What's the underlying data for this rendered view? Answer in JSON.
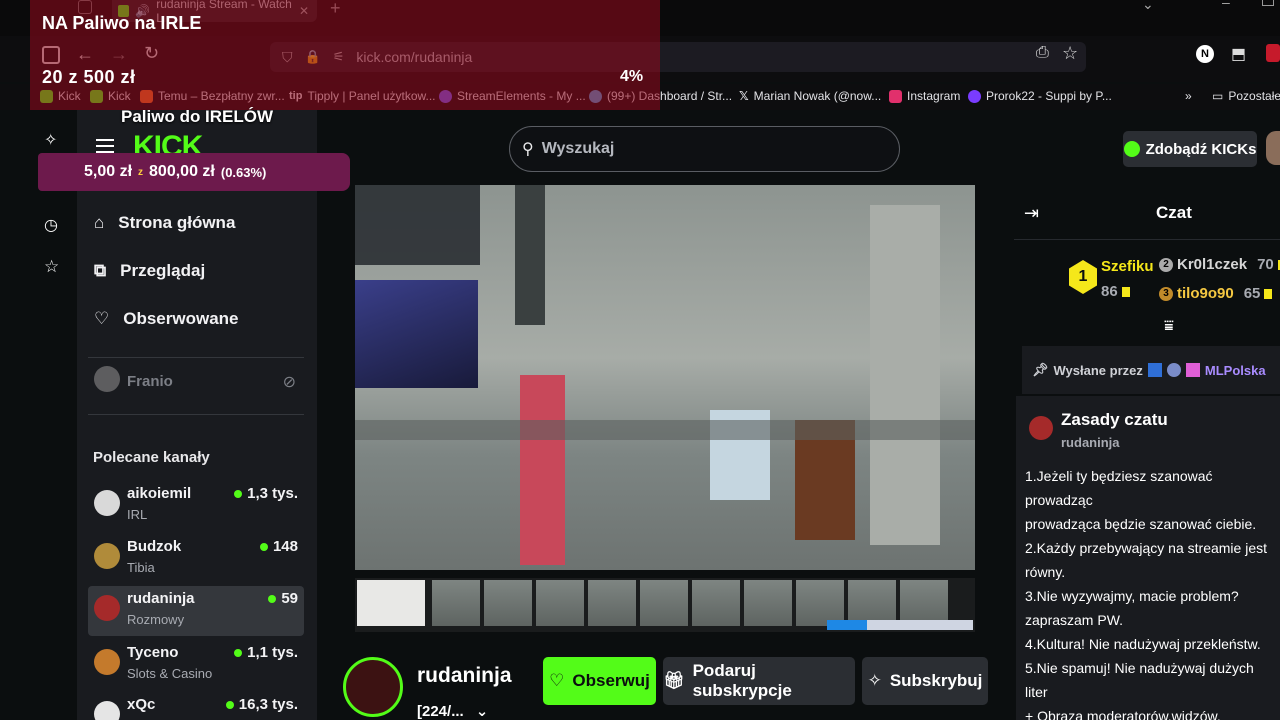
{
  "browser": {
    "tab_title": "rudaninja Stream - Watch L",
    "url": "kick.com/rudaninja",
    "bookmarks": [
      {
        "label": "Kick",
        "color": "#53fc18"
      },
      {
        "label": "Kick",
        "color": "#53fc18"
      },
      {
        "label": "Temu – Bezpłatny zwr...",
        "color": "#f37021"
      },
      {
        "label": "Tipply | Panel użytkow...",
        "color": "#1f1f22"
      },
      {
        "label": "StreamElements - My ...",
        "color": "#6e5cff"
      },
      {
        "label": "(99+) Dashboard / Str...",
        "color": "#4aa3df"
      },
      {
        "label": "Marian Nowak (@now...",
        "color": "#000000"
      },
      {
        "label": "Instagram",
        "color": "#e1306c"
      },
      {
        "label": "Prorok22 - Suppi by P...",
        "color": "#7a3cff"
      }
    ],
    "bookmarks_other": "Pozostałe"
  },
  "overlay": {
    "goal_title": "NA Paliwo na IRLE",
    "goal_amount": "20  z  500  zł",
    "goal_percent": "4%",
    "irl_title": "Paliwo do IRELÓW",
    "irl_current": "5,00 zł",
    "irl_sep": "z",
    "irl_target": "800,00 zł",
    "irl_percent": "(0.63%)"
  },
  "kick": {
    "search_placeholder": "Wyszukaj",
    "kicks_button": "Zdobądź KICKs",
    "nav": [
      {
        "label": "Strona główna",
        "icon": "home-icon"
      },
      {
        "label": "Przeglądaj",
        "icon": "browse-icon"
      },
      {
        "label": "Obserwowane",
        "icon": "heart-icon"
      }
    ],
    "followed_user": "Franio",
    "recommended_header": "Polecane kanały",
    "channels": [
      {
        "name": "aikoiemil",
        "category": "IRL",
        "viewers": "1,3 tys.",
        "avatar": "#d9d9d9"
      },
      {
        "name": "Budzok",
        "category": "Tibia",
        "viewers": "148",
        "avatar": "#b08b3a"
      },
      {
        "name": "rudaninja",
        "category": "Rozmowy",
        "viewers": "59",
        "avatar": "#a52a2a"
      },
      {
        "name": "Tyceno",
        "category": "Slots & Casino",
        "viewers": "1,1 tys.",
        "avatar": "#c47a2c"
      },
      {
        "name": "xQc",
        "category": "",
        "viewers": "16,3 tys.",
        "avatar": "#e5e5e5"
      }
    ],
    "streamer": {
      "name": "rudaninja",
      "category": "[224/...",
      "follow": "Obserwuj",
      "gift": "Podaruj subskrypcje",
      "subscribe": "Subskrybuj"
    },
    "chat": {
      "title": "Czat",
      "leaderboard": [
        {
          "rank": "1",
          "name": "Szefiku",
          "value": "86"
        },
        {
          "rank": "2",
          "name": "Kr0l1czek",
          "value": "70"
        },
        {
          "rank": "3",
          "name": "tilo9o90",
          "value": "65"
        }
      ],
      "pinned_by": "Wysłane przez",
      "pinned_user": "MLPolska",
      "rules_title": "Zasady czatu",
      "rules_author": "rudaninja",
      "rules_text": "1.Jeżeli ty będziesz szanować prowadząc\nprowadząca będzie szanować ciebie.\n2.Każdy przebywający na streamie jest\nrówny.\n3.Nie wyzywajmy, macie problem?\nzapraszam PW.\n4.Kultura! Nie nadużywaj przekleństw.\n5.Nie spamuj! Nie nadużywaj dużych liter\n+ Obraza moderatorów,widzów,\nprowadzącej ⟶ TIMEOUT⟶ BAN\n+ Spamowanie, reklamowanie, capslock"
    }
  },
  "colors": {
    "kick_green": "#53fc18",
    "sidebar_bg": "#191b1f",
    "overlay_red": "#960a1e",
    "overlay_purple": "#6d1a4c"
  }
}
